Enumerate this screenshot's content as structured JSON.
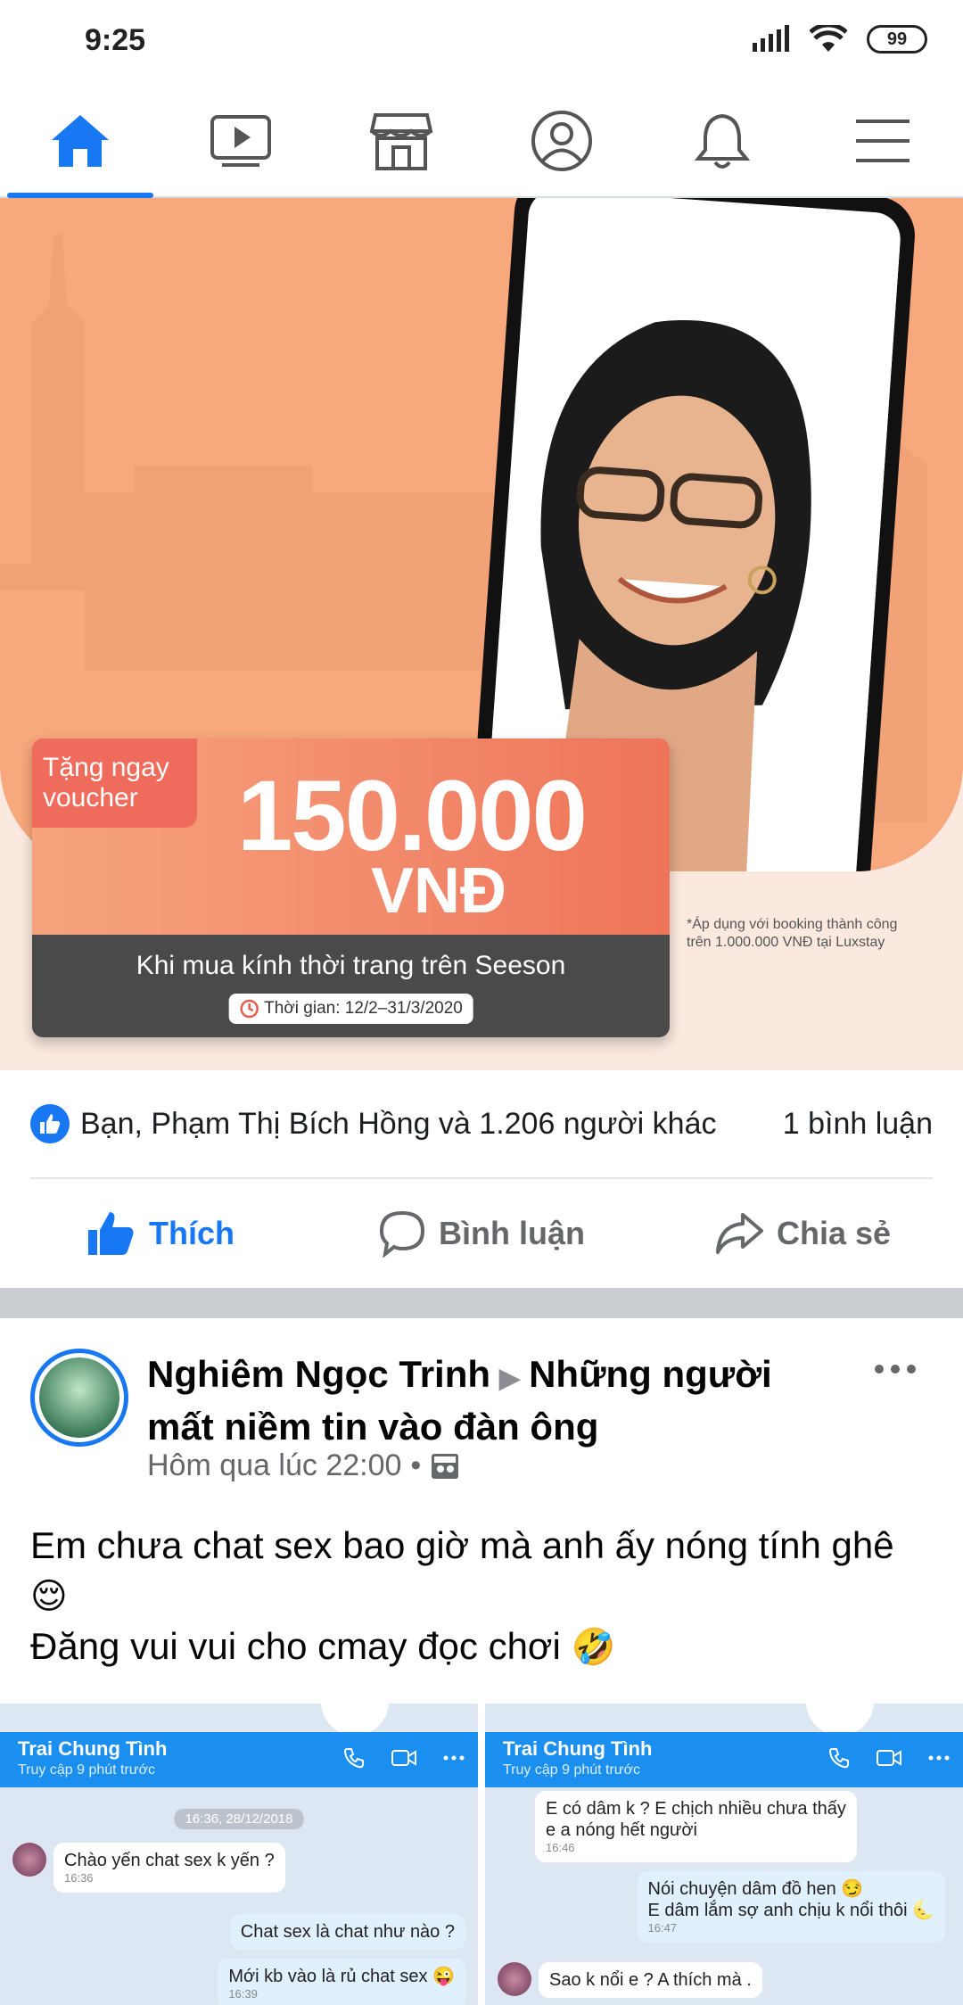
{
  "status": {
    "time": "9:25",
    "battery": "99"
  },
  "nav": {
    "items": [
      "home",
      "watch",
      "marketplace",
      "profile",
      "notifications",
      "menu"
    ]
  },
  "ad": {
    "tag_line1": "Tặng ngay",
    "tag_line2": "voucher",
    "amount": "150.000",
    "currency": "VNĐ",
    "description": "Khi mua kính thời trang trên Seeson",
    "time": "Thời gian: 12/2–31/3/2020",
    "note_line1": "*Áp dụng với booking thành công",
    "note_line2": "trên 1.000.000 VNĐ tại Luxstay"
  },
  "reactions": {
    "text": "Bạn, Phạm Thị Bích Hồng và 1.206 người khác",
    "comments": "1 bình luận"
  },
  "actions": {
    "like": "Thích",
    "comment": "Bình luận",
    "share": "Chia sẻ"
  },
  "post": {
    "author": "Nghiêm Ngọc Trinh",
    "group": "Những người mất niềm tin vào đàn ông",
    "time": "Hôm qua lúc 22:00",
    "dot": "•",
    "line1": "Em chưa chat sex bao giờ mà anh ấy nóng tính ghê",
    "emoji1": "😌",
    "line2": "Đăng vui vui cho cmay đọc chơi",
    "emoji2": "🤣"
  },
  "shots": [
    {
      "name": "Trai Chung Tình",
      "sub": "Truy cập 9 phút trước",
      "date": "16:36, 28/12/2018",
      "b1": "Chào yến chat sex k yến ?",
      "b1t": "16:36",
      "b2": "Chat sex là chat như nào ?",
      "b3": "Mới kb vào là rủ chat sex 😜",
      "b3t": "16:39"
    },
    {
      "name": "Trai Chung Tình",
      "sub": "Truy cập 9 phút trước",
      "b1a": "E có dâm k ? E chịch nhiều chưa thấy",
      "b1b": "e a nóng hết người",
      "b1t": "16:46",
      "b2a": "Nói chuyện dâm đồ hen 😏",
      "b2b": "E dâm lắm sợ anh chịu k nổi thôi 🌜",
      "b2t": "16:47",
      "b3": "Sao k nổi e ? A thích mà ."
    }
  ],
  "colors": {
    "primary": "#1877f2",
    "ad_bg": "#f7a87c",
    "voucher_red": "#ef6b5b"
  }
}
